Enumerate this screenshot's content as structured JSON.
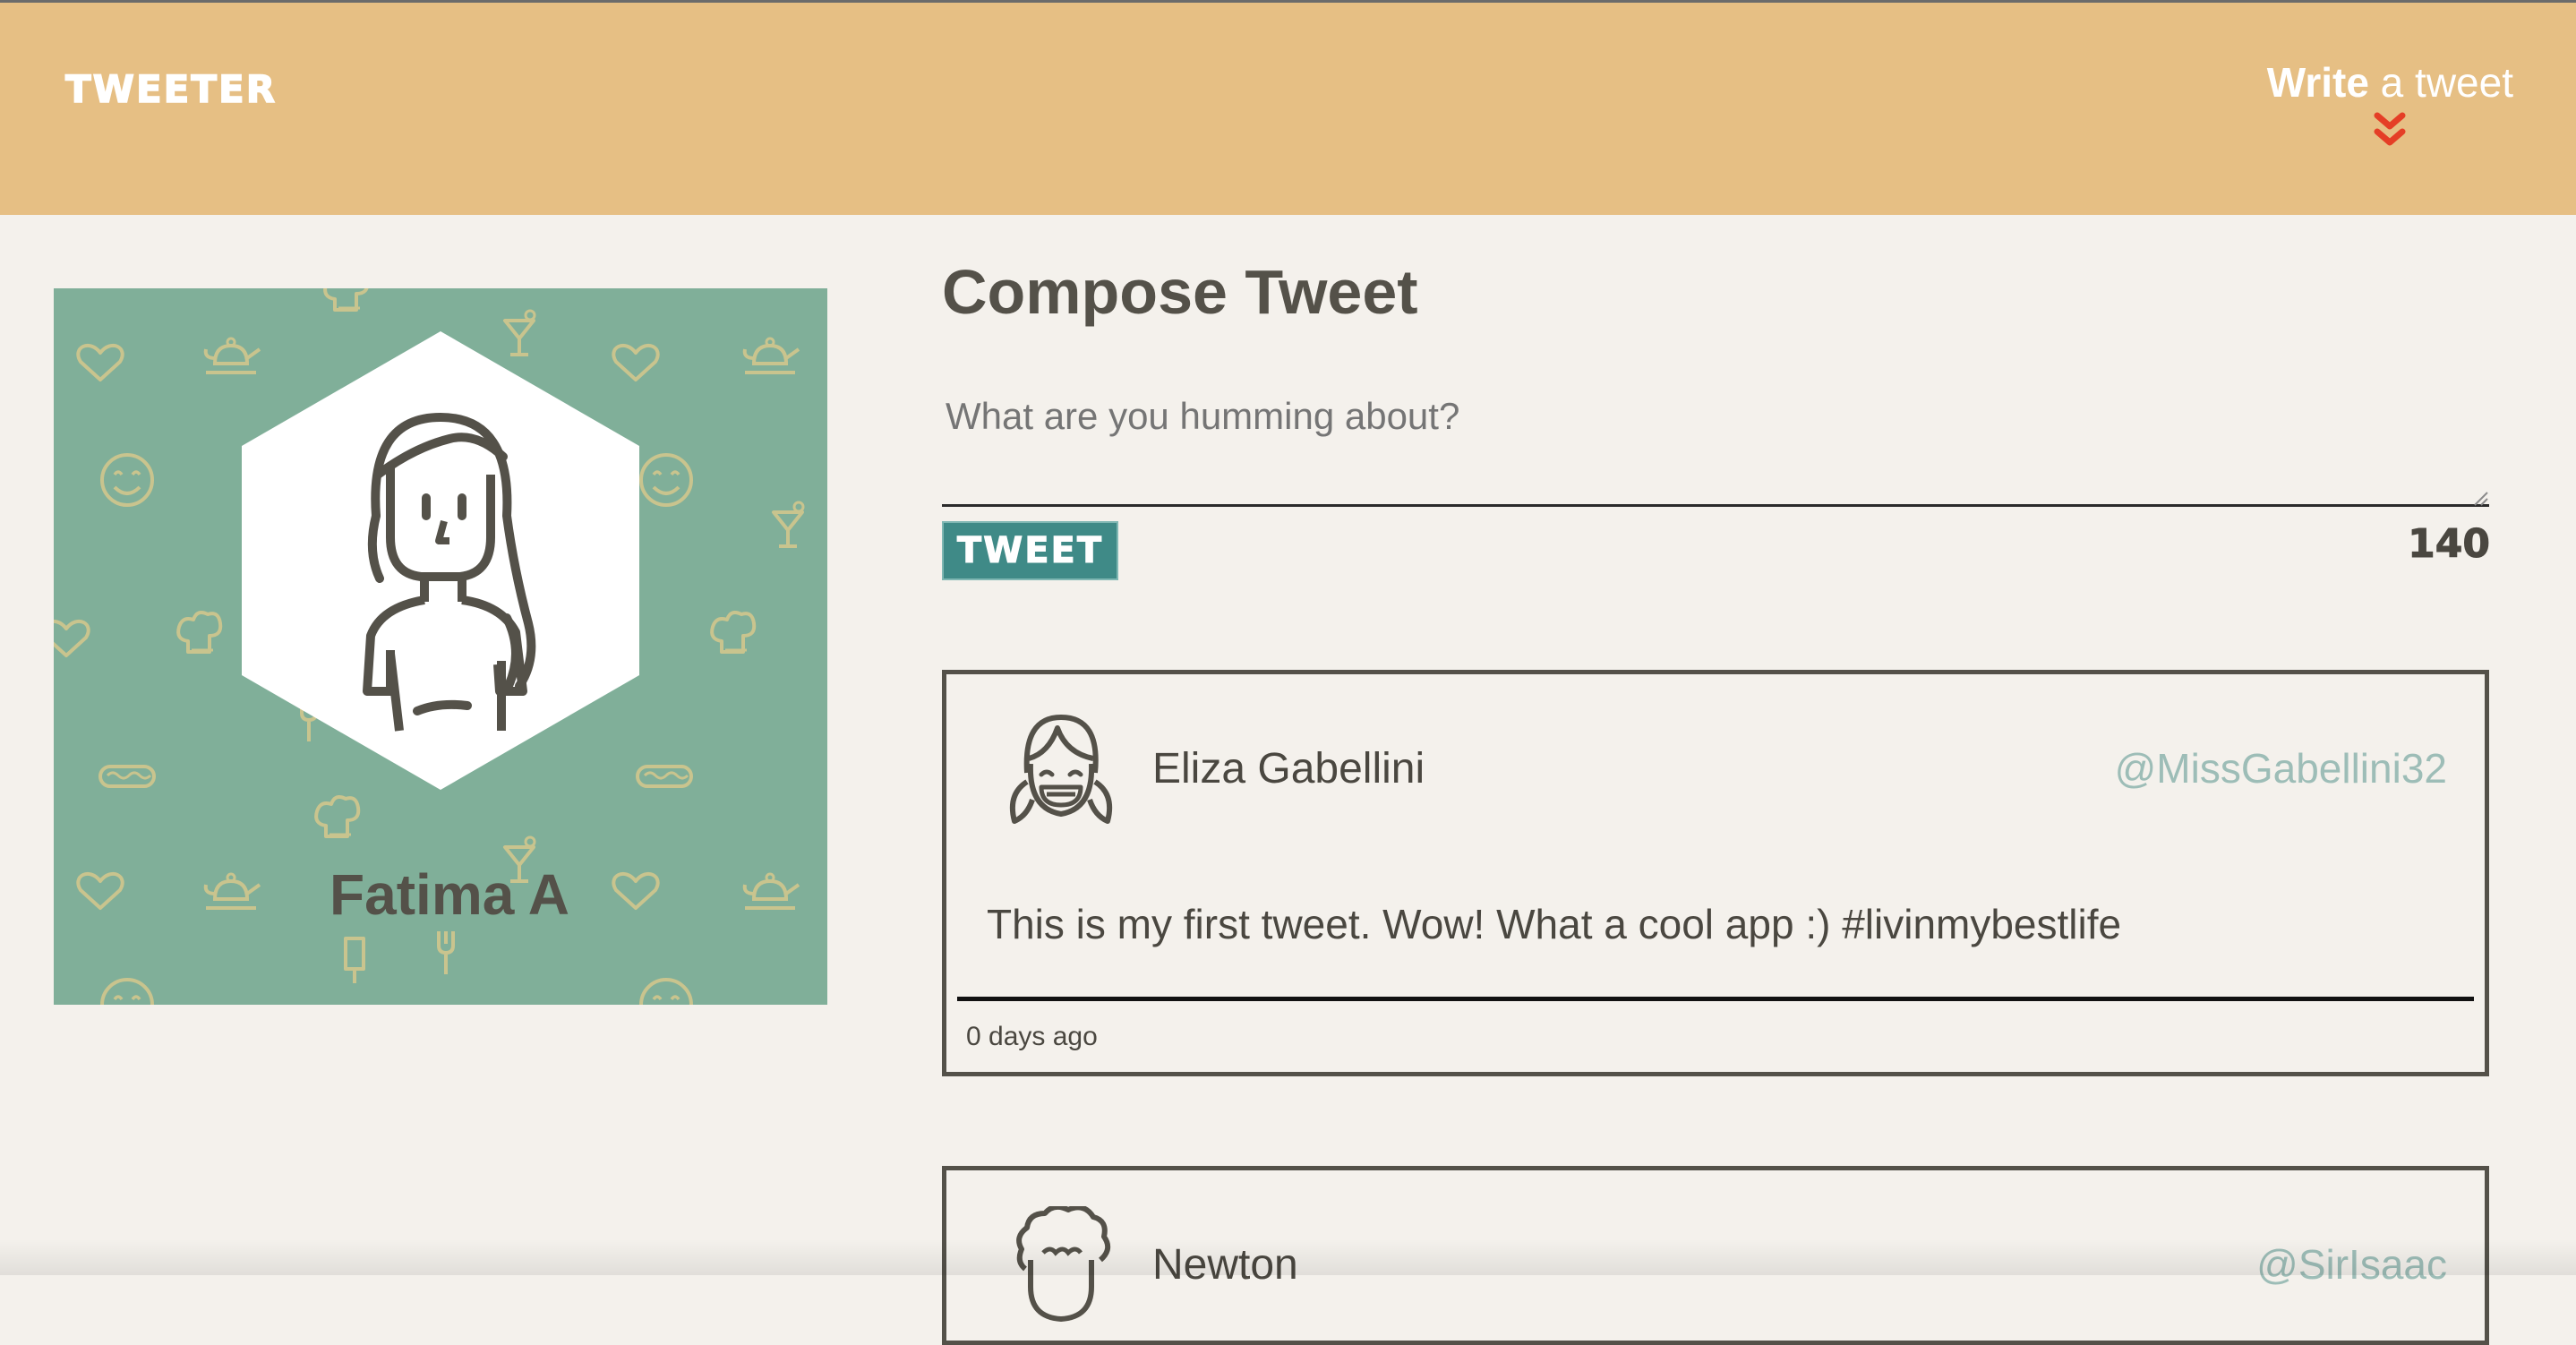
{
  "header": {
    "brand": "TWEETER",
    "write_strong": "Write",
    "write_rest": " a tweet",
    "toggle_icon": "double-chevron-down-icon",
    "accent_color": "#e53e26",
    "background_color": "#e6bf84"
  },
  "profile": {
    "name": "Fatima A",
    "avatar_icon": "woman-avatar-icon",
    "background_color": "#80af99"
  },
  "compose": {
    "title": "Compose Tweet",
    "placeholder": "What are you humming about?",
    "button_label": "TWEET",
    "char_count": "140",
    "button_color": "#3f8a87"
  },
  "tweets": [
    {
      "name": "Eliza Gabellini",
      "handle": "@MissGabellini32",
      "text": "This is my first tweet. Wow! What a cool app :) #livinmybestlife",
      "time": "0 days ago",
      "avatar_icon": "girl-avatar-icon"
    },
    {
      "name": "Newton",
      "handle": "@SirIsaac",
      "avatar_icon": "curly-hair-avatar-icon"
    }
  ]
}
